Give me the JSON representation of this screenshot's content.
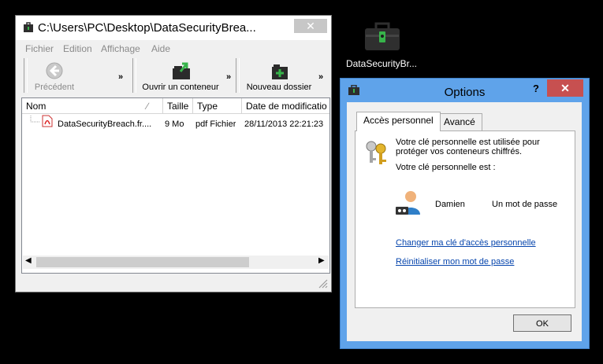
{
  "explorer": {
    "title": "C:\\Users\\PC\\Desktop\\DataSecurityBrea...",
    "close_glyph": "✕",
    "menu": [
      "Fichier",
      "Edition",
      "Affichage",
      "Aide"
    ],
    "toolbar": {
      "back_label": "Précédent",
      "open_label": "Ouvrir un conteneur",
      "newfolder_label": "Nouveau dossier",
      "more_glyph": "»"
    },
    "columns": [
      "Nom",
      "Taille",
      "Type",
      "Date de modificatio"
    ],
    "rows": [
      {
        "name": "DataSecurityBreach.fr....",
        "size": "9 Mo",
        "type": "pdf Fichier",
        "date": "28/11/2013 22:21:23"
      }
    ],
    "icons": {
      "title": "safe-icon",
      "back": "back-arrow-icon",
      "open": "folder-open-icon",
      "newfolder": "new-folder-icon",
      "file": "pdf-file-icon"
    }
  },
  "desktop_icon": {
    "label": "DataSecurityBr...",
    "icon": "briefcase-safe-icon"
  },
  "options": {
    "title": "Options",
    "help_glyph": "?",
    "close_glyph": "✕",
    "tabs": [
      "Accès personnel",
      "Avancé"
    ],
    "active_tab": "Accès personnel",
    "description_line1": "Votre clé personnelle est utilisée pour",
    "description_line2": "protéger vos conteneurs chiffrés.",
    "key_is_label": "Votre clé personnelle est :",
    "user_name": "Damien",
    "key_type": "Un mot de passe",
    "change_key_link": "Changer ma clé d'accès personnelle",
    "reset_password_link": "Réinitialiser mon mot de passe",
    "ok_label": "OK"
  },
  "colors": {
    "dialog_frame": "#5fa3ea",
    "close_red": "#c75050",
    "link_blue": "#0645ad",
    "desktop": "#000000"
  }
}
